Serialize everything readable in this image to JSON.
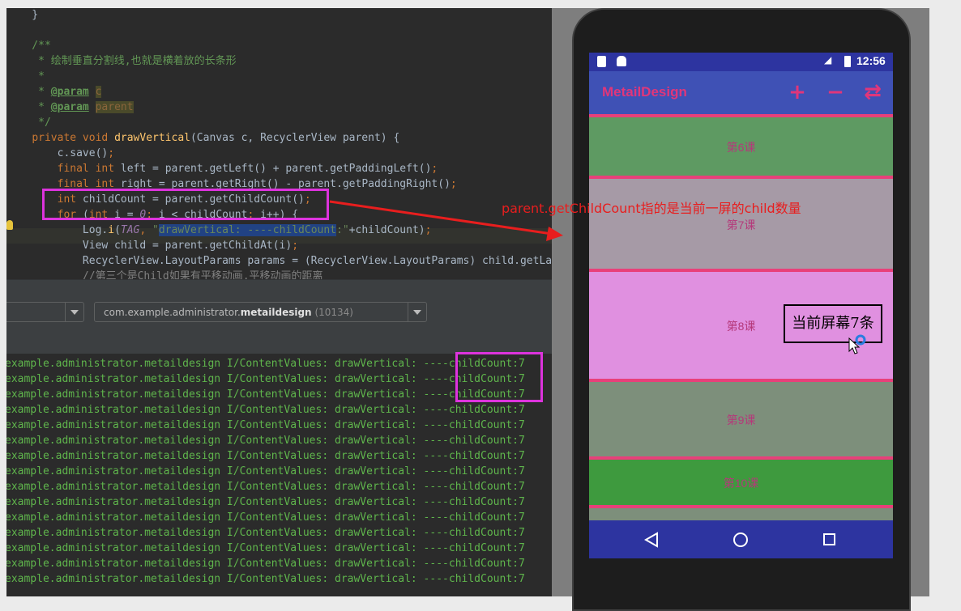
{
  "editor": {
    "lines": [
      {
        "parts": [
          {
            "t": "    }",
            "c": ""
          }
        ]
      },
      {
        "parts": [
          {
            "t": "",
            "c": ""
          }
        ]
      },
      {
        "parts": [
          {
            "t": "    /**",
            "c": "c-com"
          }
        ]
      },
      {
        "parts": [
          {
            "t": "     * 绘制垂直分割线,也就是横着放的长条形",
            "c": "c-com"
          }
        ]
      },
      {
        "parts": [
          {
            "t": "     *",
            "c": "c-com"
          }
        ]
      },
      {
        "parts": [
          {
            "t": "     * ",
            "c": "c-com"
          },
          {
            "t": "@param",
            "c": "c-param"
          },
          {
            "t": " ",
            "c": "c-com"
          },
          {
            "t": "c",
            "c": "c-pname"
          }
        ]
      },
      {
        "parts": [
          {
            "t": "     * ",
            "c": "c-com"
          },
          {
            "t": "@param",
            "c": "c-param"
          },
          {
            "t": " ",
            "c": "c-com"
          },
          {
            "t": "parent",
            "c": "c-pname"
          }
        ]
      },
      {
        "parts": [
          {
            "t": "     */",
            "c": "c-com"
          }
        ]
      },
      {
        "parts": [
          {
            "t": "    ",
            "c": ""
          },
          {
            "t": "private void ",
            "c": "c-kw"
          },
          {
            "t": "drawVertical",
            "c": "c-fn"
          },
          {
            "t": "(Canvas c, RecyclerView parent) {",
            "c": ""
          }
        ]
      },
      {
        "parts": [
          {
            "t": "        c.save()",
            "c": ""
          },
          {
            "t": ";",
            "c": "c-kw"
          }
        ]
      },
      {
        "parts": [
          {
            "t": "        ",
            "c": ""
          },
          {
            "t": "final int ",
            "c": "c-kw"
          },
          {
            "t": "left = parent.getLeft() + parent.getPaddingLeft()",
            "c": ""
          },
          {
            "t": ";",
            "c": "c-kw"
          }
        ]
      },
      {
        "parts": [
          {
            "t": "        ",
            "c": ""
          },
          {
            "t": "final int ",
            "c": "c-kw"
          },
          {
            "t": "right = parent.getRight() - parent.getPaddingRight()",
            "c": ""
          },
          {
            "t": ";",
            "c": "c-kw"
          }
        ]
      },
      {
        "parts": [
          {
            "t": "        ",
            "c": ""
          },
          {
            "t": "int ",
            "c": "c-kw"
          },
          {
            "t": "childCount = parent.getChildCount()",
            "c": ""
          },
          {
            "t": ";",
            "c": "c-kw"
          }
        ]
      },
      {
        "parts": [
          {
            "t": "        ",
            "c": ""
          },
          {
            "t": "for ",
            "c": "c-kw"
          },
          {
            "t": "(",
            "c": ""
          },
          {
            "t": "int ",
            "c": "c-kw"
          },
          {
            "t": "i = ",
            "c": ""
          },
          {
            "t": "0",
            "c": "c-tag"
          },
          {
            "t": "; ",
            "c": "c-kw"
          },
          {
            "t": "i < childCount",
            "c": ""
          },
          {
            "t": "; ",
            "c": "c-kw"
          },
          {
            "t": "i++) {",
            "c": ""
          }
        ]
      },
      {
        "parts": [
          {
            "t": "            Log.",
            "c": ""
          },
          {
            "t": "i",
            "c": "c-fn"
          },
          {
            "t": "(",
            "c": ""
          },
          {
            "t": "TAG",
            "c": "c-tag"
          },
          {
            "t": ", ",
            "c": "c-kw"
          },
          {
            "t": "\"",
            "c": "c-str"
          },
          {
            "t": "drawVertical: ----childCount",
            "c": "c-str sel"
          },
          {
            "t": ":\"",
            "c": "c-str"
          },
          {
            "t": "+childCount)",
            "c": ""
          },
          {
            "t": ";",
            "c": "c-kw"
          }
        ]
      },
      {
        "parts": [
          {
            "t": "            View child = parent.getChildAt(i)",
            "c": ""
          },
          {
            "t": ";",
            "c": "c-kw"
          }
        ]
      },
      {
        "parts": [
          {
            "t": "            RecyclerView.LayoutParams params = (RecyclerView.LayoutParams) child.getLa",
            "c": ""
          }
        ]
      },
      {
        "parts": [
          {
            "t": "            //第三个是Child如果有平移动画,平移动画的距离",
            "c": "c-gray"
          }
        ]
      }
    ]
  },
  "toolbar": {
    "device_combo_value": "",
    "process_combo_prefix": "com.example.administrator.",
    "process_combo_bold": "metaildesign",
    "process_combo_pid": "(10134)"
  },
  "log": {
    "prefix": "example.administrator.metaildesign I/ContentValues: drawVertical: ----",
    "suffix": "childCount:7",
    "count": 15
  },
  "phone": {
    "status_time": "12:56",
    "app_title": "MetailDesign",
    "actions": [
      "+",
      "−",
      "⇄"
    ],
    "items": [
      {
        "label": "第6课",
        "color": "#5e9a62",
        "height": 72
      },
      {
        "label": "第7课",
        "color": "#a69aa6",
        "height": 111
      },
      {
        "label": "第8课",
        "color": "#e090e0",
        "height": 132
      },
      {
        "label": "第9课",
        "color": "#7d8f7b",
        "height": 92
      },
      {
        "label": "第10课",
        "color": "#3e9a3e",
        "height": 56
      },
      {
        "label": "",
        "color": "#7d8f7b",
        "height": 40
      }
    ],
    "nav": [
      "back-icon",
      "home-icon",
      "recents-icon"
    ]
  },
  "annotations": {
    "arrow_label": "parent.getChildCount指的是当前一屏的child数量",
    "note": "当前屏幕7条"
  },
  "colors": {
    "highlight": "#dd33dd",
    "arrow": "#e81e1e"
  }
}
